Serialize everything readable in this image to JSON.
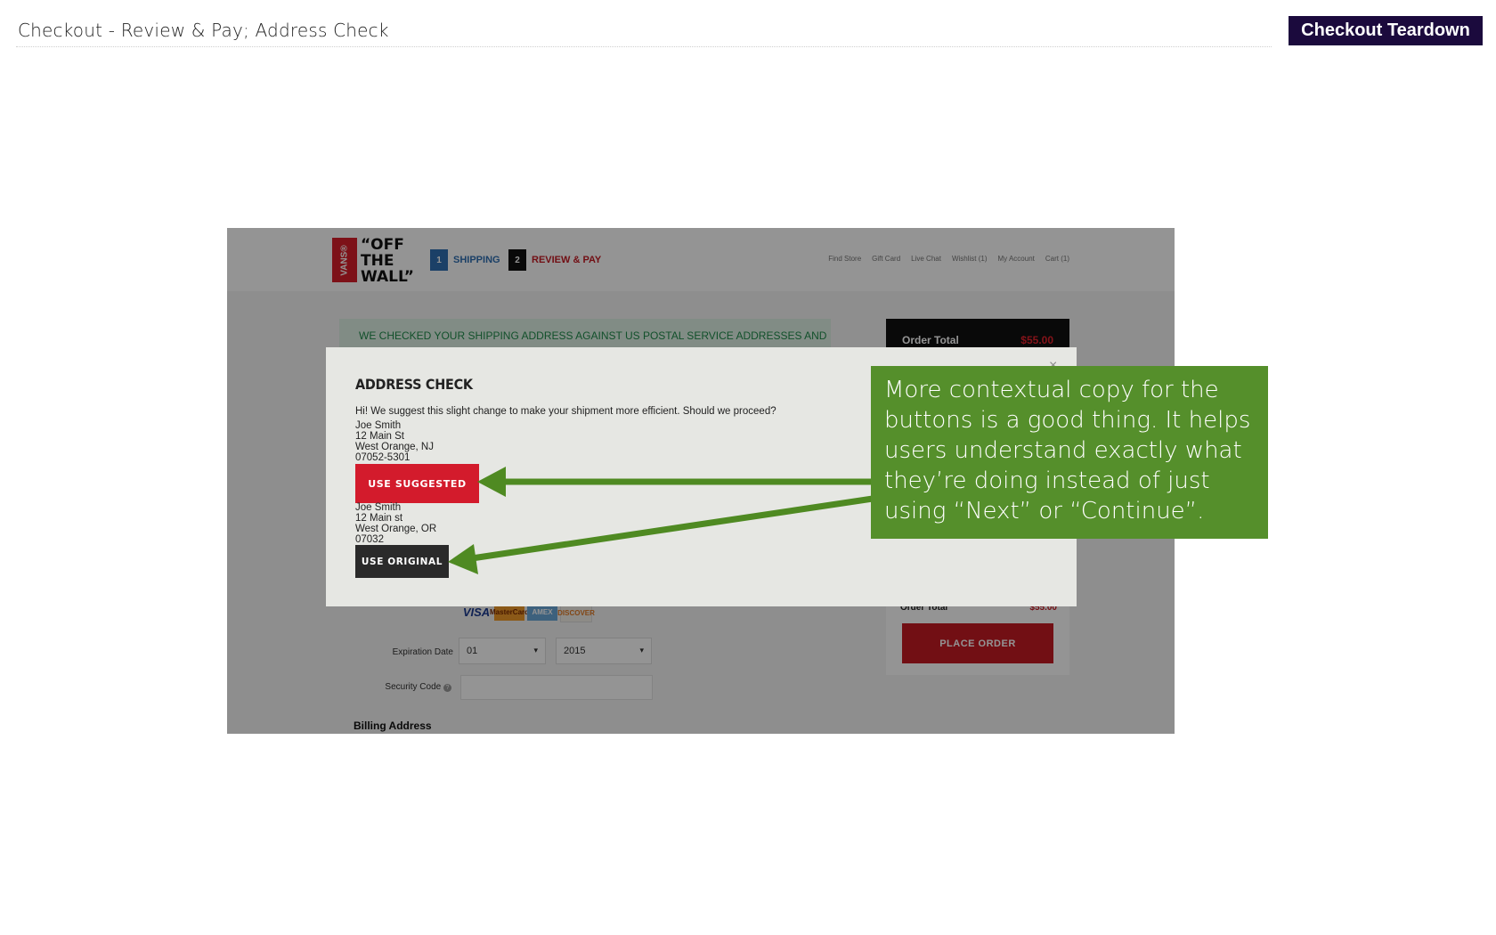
{
  "slide": {
    "title": "Checkout - Review & Pay; Address Check",
    "badge": "Checkout Teardown"
  },
  "site": {
    "logo_brand": "VANS®",
    "logo_tagline": "“OFF\nTHE\nWALL”",
    "steps": [
      {
        "number": "1",
        "label": "SHIPPING"
      },
      {
        "number": "2",
        "label": "REVIEW & PAY"
      }
    ],
    "top_links": [
      "Find Store",
      "Gift Card",
      "Live Chat",
      "Wishlist (1)",
      "My Account",
      "Cart (1)"
    ],
    "notice": "WE CHECKED YOUR SHIPPING ADDRESS AGAINST US POSTAL SERVICE ADDRESSES AND",
    "order_total_label": "Order Total",
    "order_total_value": "$55.00",
    "order_total_label_2": "Order Total",
    "order_total_value_2": "$55.00",
    "place_order": "PLACE ORDER",
    "cards": [
      "VISA",
      "MasterCard",
      "AMEX",
      "DISCOVER"
    ],
    "expiration_label": "Expiration Date",
    "exp_month": "01",
    "exp_year": "2015",
    "security_label": "Security Code",
    "billing_label": "Billing Address"
  },
  "modal": {
    "title": "ADDRESS CHECK",
    "message": "Hi! We suggest this slight change to make your shipment more efficient. Should we proceed?",
    "suggested_address": [
      "Joe Smith",
      "12 Main St",
      "West Orange, NJ",
      "07052-5301"
    ],
    "use_suggested": "USE SUGGESTED",
    "original_address": [
      "Joe Smith",
      "12 Main st",
      "West Orange, OR",
      "07032"
    ],
    "use_original": "USE ORIGINAL",
    "close_icon": "×"
  },
  "annotation": {
    "text": "More contextual copy for the buttons is a good thing. It helps users understand exactly what they’re doing instead of just using “Next” or “Continue”."
  },
  "colors": {
    "badge_bg": "#1b0a3d",
    "annotation_bg": "#558f2b",
    "arrow": "#4f8a22",
    "suggest_btn": "#d31b2c",
    "original_btn": "#2a2a2a",
    "place_order_btn": "#c41a24"
  }
}
